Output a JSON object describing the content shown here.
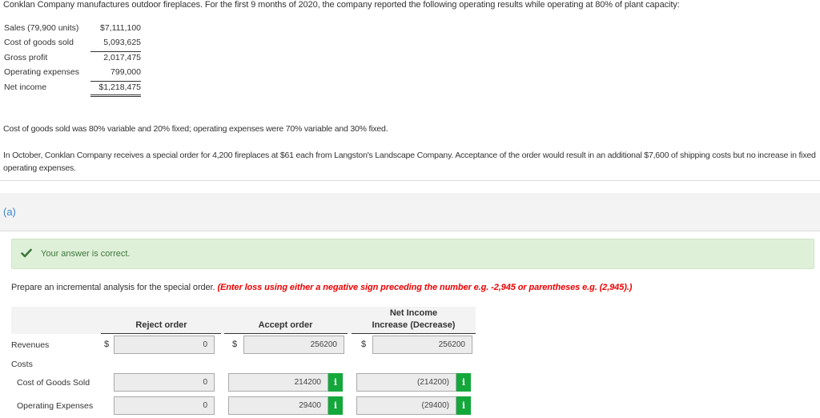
{
  "intro": "Conklan Company manufactures outdoor fireplaces. For the first 9 months of 2020, the company reported the following operating results while operating at 80% of plant capacity:",
  "income_statement": [
    {
      "label": "Sales (79,900 units)",
      "value": "$7,111,100"
    },
    {
      "label": "Cost of goods sold",
      "value": "5,093,625"
    },
    {
      "label": "Gross profit",
      "value": "2,017,475"
    },
    {
      "label": "Operating expenses",
      "value": "799,000"
    },
    {
      "label": "Net income",
      "value": "$1,218,475"
    }
  ],
  "note_cost_behavior": "Cost of goods sold was 80% variable and 20% fixed; operating expenses were 70% variable and 30% fixed.",
  "note_special_order": "In October, Conklan Company receives a special order for 4,200 fireplaces at $61 each from Langston's Landscape Company. Acceptance of the order would result in an additional $7,600 of shipping costs but no increase in fixed operating expenses.",
  "part": {
    "label": "(a)",
    "feedback": "Your answer is correct.",
    "prompt": "Prepare an incremental analysis for the special order.",
    "instruction": "(Enter loss using either a negative sign preceding the number e.g. -2,945 or parentheses e.g. (2,945).)"
  },
  "analysis": {
    "columns": [
      "Reject order",
      "Accept order",
      "Net Income",
      "Increase (Decrease)"
    ],
    "currency_symbol": "$",
    "info_icon": "i",
    "rows": {
      "revenues": {
        "label": "Revenues",
        "reject": "0",
        "accept": "256200",
        "net": "256200"
      },
      "costs": {
        "label": "Costs"
      },
      "cogs": {
        "label": "Cost of Goods Sold",
        "reject": "0",
        "accept": "214200",
        "net": "(214200)"
      },
      "opex": {
        "label": "Operating Expenses",
        "reject": "0",
        "accept": "29400",
        "net": "(29400)"
      }
    }
  },
  "colors": {
    "accent_blue": "#3a87c8",
    "success_bg": "#dff0d8",
    "success_text": "#3c763d",
    "instruction_red": "#ee0000",
    "info_green": "#14a83b"
  }
}
